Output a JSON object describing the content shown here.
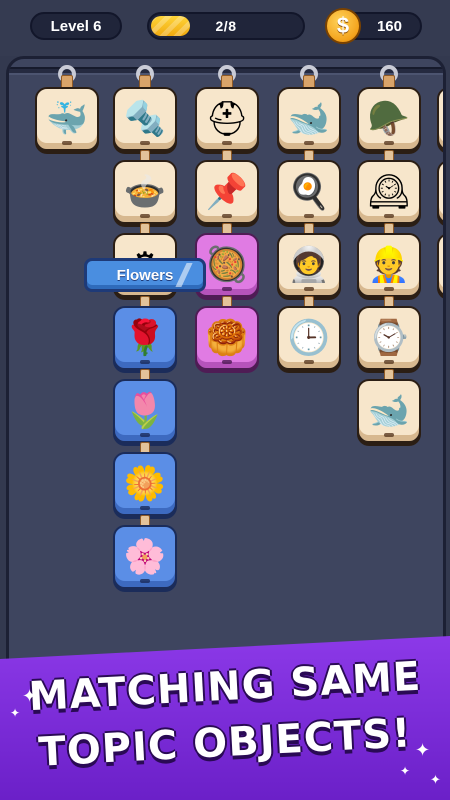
{
  "hud": {
    "level_label": "Level 6",
    "progress_text": "2/8",
    "progress_fraction": 0.25,
    "coins": "160",
    "coin_symbol": "$"
  },
  "category_tag": "Flowers",
  "columns": [
    {
      "tiles": [
        {
          "icon": "narwhal-icon",
          "glyph": "🐳",
          "style": "cream"
        }
      ]
    },
    {
      "tiles": [
        {
          "icon": "bolt-icon",
          "glyph": "🔩",
          "style": "cream"
        },
        {
          "icon": "cooking-pot-icon",
          "glyph": "🍲",
          "style": "cream"
        },
        {
          "icon": "sink-drain-icon",
          "glyph": "⚙",
          "style": "cream"
        },
        {
          "icon": "rose-icon",
          "glyph": "🌹",
          "style": "blue"
        },
        {
          "icon": "tulip-icon",
          "glyph": "🌷",
          "style": "blue"
        },
        {
          "icon": "lily-icon",
          "glyph": "🌼",
          "style": "blue"
        },
        {
          "icon": "peony-icon",
          "glyph": "🌸",
          "style": "blue"
        }
      ]
    },
    {
      "tiles": [
        {
          "icon": "batting-helmet-icon",
          "glyph": "⛑",
          "style": "cream"
        },
        {
          "icon": "nail-icon",
          "glyph": "📌",
          "style": "cream"
        },
        {
          "icon": "wok-icon",
          "glyph": "🥘",
          "style": "pink"
        },
        {
          "icon": "dumpling-steamer-icon",
          "glyph": "🥮",
          "style": "pink"
        }
      ]
    },
    {
      "tiles": [
        {
          "icon": "beluga-whale-icon",
          "glyph": "🐋",
          "style": "cream"
        },
        {
          "icon": "stock-pot-icon",
          "glyph": "🍳",
          "style": "cream"
        },
        {
          "icon": "astronaut-helmet-icon",
          "glyph": "🧑‍🚀",
          "style": "cream"
        },
        {
          "icon": "wall-clock-icon",
          "glyph": "🕒",
          "style": "cream"
        }
      ]
    },
    {
      "tiles": [
        {
          "icon": "firefighter-helmet-icon",
          "glyph": "🪖",
          "style": "cream"
        },
        {
          "icon": "big-ben-icon",
          "glyph": "🕰",
          "style": "cream"
        },
        {
          "icon": "hard-hat-icon",
          "glyph": "👷",
          "style": "cream"
        },
        {
          "icon": "wristwatch-icon",
          "glyph": "⌚",
          "style": "cream"
        },
        {
          "icon": "blue-whale-icon",
          "glyph": "🐋",
          "style": "cream"
        }
      ]
    }
  ],
  "banner": {
    "line1": "MATCHING SAME",
    "line2": "TOPIC OBJECTS!"
  },
  "colors": {
    "background": "#33394f",
    "tile_cream": "#f7e6cb",
    "tile_blue": "#5b8ee6",
    "tile_pink": "#e07be3",
    "banner_purple": "#7c2cd9",
    "progress_yellow": "#ffd53a"
  }
}
